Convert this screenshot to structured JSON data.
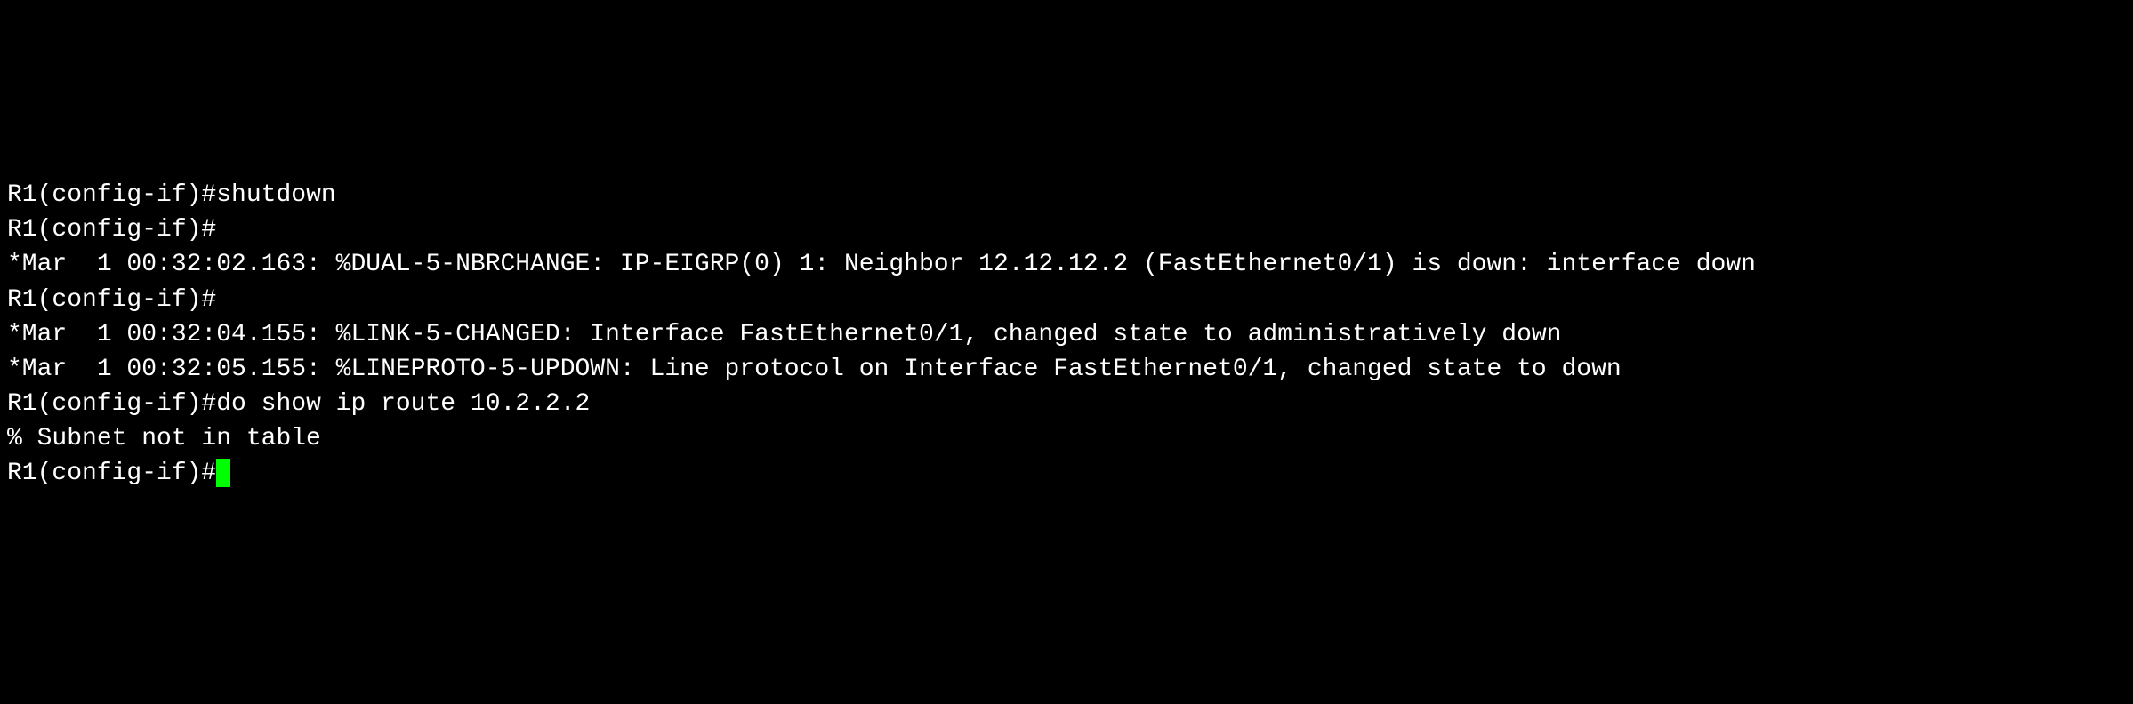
{
  "terminal": {
    "lines": [
      {
        "prompt": "R1(config-if)#",
        "command": "shutdown"
      },
      {
        "prompt": "R1(config-if)#",
        "command": ""
      },
      {
        "text": "*Mar  1 00:32:02.163: %DUAL-5-NBRCHANGE: IP-EIGRP(0) 1: Neighbor 12.12.12.2 (FastEthernet0/1) is down: interface down"
      },
      {
        "prompt": "R1(config-if)#",
        "command": ""
      },
      {
        "text": "*Mar  1 00:32:04.155: %LINK-5-CHANGED: Interface FastEthernet0/1, changed state to administratively down"
      },
      {
        "text": "*Mar  1 00:32:05.155: %LINEPROTO-5-UPDOWN: Line protocol on Interface FastEthernet0/1, changed state to down"
      },
      {
        "prompt": "R1(config-if)#",
        "command": "do show ip route 10.2.2.2"
      },
      {
        "text": "% Subnet not in table"
      },
      {
        "prompt": "R1(config-if)#",
        "command": "",
        "cursor": true
      }
    ]
  }
}
